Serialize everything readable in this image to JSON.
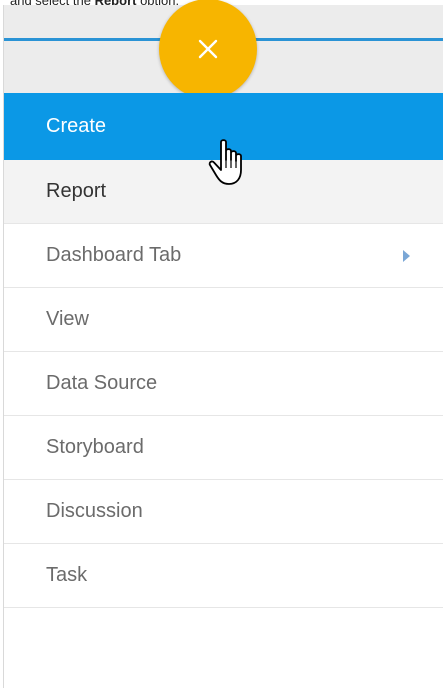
{
  "instruction": {
    "prefix": "and select the ",
    "bold": "Report",
    "suffix": " option."
  },
  "close_button": {
    "icon": "close-icon",
    "color": "#f7b500"
  },
  "menu": {
    "header_label": "Create",
    "items": [
      {
        "label": "Report",
        "has_submenu": false,
        "hovered": true
      },
      {
        "label": "Dashboard Tab",
        "has_submenu": true,
        "hovered": false
      },
      {
        "label": "View",
        "has_submenu": false,
        "hovered": false
      },
      {
        "label": "Data Source",
        "has_submenu": false,
        "hovered": false
      },
      {
        "label": "Storyboard",
        "has_submenu": false,
        "hovered": false
      },
      {
        "label": "Discussion",
        "has_submenu": false,
        "hovered": false
      },
      {
        "label": "Task",
        "has_submenu": false,
        "hovered": false
      }
    ]
  },
  "colors": {
    "header_bg": "#0b98e6",
    "accent_line": "#2a93d5",
    "fab": "#f7b500"
  },
  "cursor": {
    "icon": "hand-pointer-icon"
  }
}
